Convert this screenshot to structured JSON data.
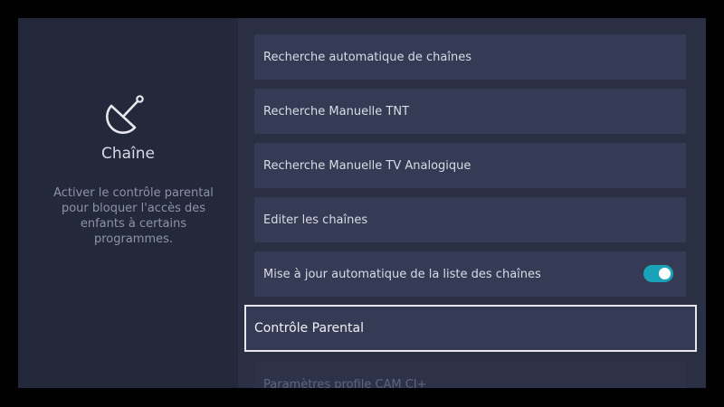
{
  "left_panel": {
    "icon": "satellite-dish-icon",
    "title": "Chaîne",
    "description": "Activer le contrôle parental pour bloquer l'accès des enfants à certains programmes."
  },
  "menu": {
    "items": [
      {
        "label": "Recherche automatique de chaînes"
      },
      {
        "label": "Recherche Manuelle TNT"
      },
      {
        "label": "Recherche Manuelle TV Analogique"
      },
      {
        "label": "Editer les chaînes"
      },
      {
        "label": "Mise à jour automatique de la liste des chaînes",
        "toggle": true
      },
      {
        "label": "Contrôle Parental",
        "selected": true
      },
      {
        "label": "Paramètres profile CAM CI+"
      }
    ]
  },
  "colors": {
    "toggle_on": "#1aa3b8",
    "selection_border": "#e6e8ee"
  }
}
